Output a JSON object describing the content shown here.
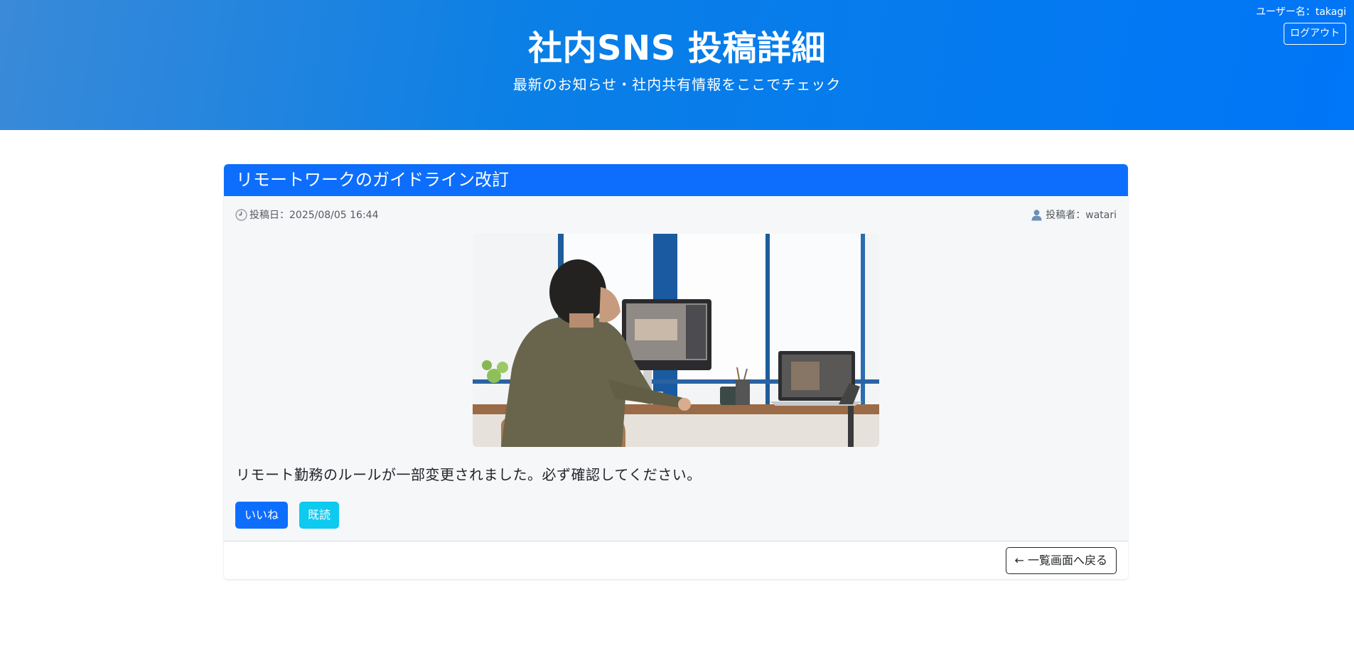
{
  "header": {
    "title": "社内SNS 投稿詳細",
    "subtitle": "最新のお知らせ・社内共有情報をここでチェック"
  },
  "user": {
    "username_label": "ユーザー名：takagi",
    "logout_label": "ログアウト"
  },
  "post": {
    "title": "リモートワークのガイドライン改訂",
    "date_label": "投稿日：2025/08/05 16:44",
    "author_label": "投稿者：watari",
    "body": "リモート勤務のルールが一部変更されました。必ず確認してください。",
    "image_icon": "photo-person-at-desk"
  },
  "actions": {
    "like_label": "いいね",
    "read_label": "既読",
    "back_label": "← 一覧画面へ戻る"
  },
  "colors": {
    "header_gradient_start": "#3a8ad8",
    "header_gradient_end": "#0076f8",
    "primary": "#0d6efd",
    "info": "#0dcaf0",
    "card_bg": "#f6f7f9"
  }
}
